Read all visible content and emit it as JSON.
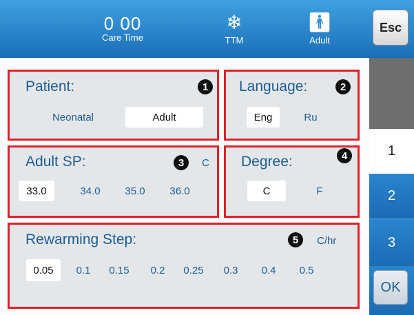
{
  "header": {
    "care_time_value": "0 00",
    "care_time_label": "Care Time",
    "ttm_icon": "snowflake-icon",
    "ttm_label": "TTM",
    "adult_icon": "person-icon",
    "adult_label": "Adult",
    "esc_label": "Esc"
  },
  "side_tabs": {
    "tab1": "1",
    "tab2": "2",
    "tab3": "3",
    "ok_label": "OK"
  },
  "patient": {
    "title": "Patient:",
    "badge": "1",
    "options": [
      "Neonatal",
      "Adult"
    ],
    "selected": "Adult"
  },
  "language": {
    "title": "Language:",
    "badge": "2",
    "options": [
      "Eng",
      "Ru"
    ],
    "selected": "Eng"
  },
  "adult_sp": {
    "title": "Adult SP:",
    "badge": "3",
    "unit": "C",
    "options": [
      "33.0",
      "34.0",
      "35.0",
      "36.0"
    ],
    "selected": "33.0"
  },
  "degree": {
    "title": "Degree:",
    "badge": "4",
    "options": [
      "C",
      "F"
    ],
    "selected": "C"
  },
  "rewarming": {
    "title": "Rewarming Step:",
    "badge": "5",
    "unit": "C/hr",
    "options": [
      "0.05",
      "0.1",
      "0.15",
      "0.2",
      "0.25",
      "0.3",
      "0.4",
      "0.5"
    ],
    "selected": "0.05"
  },
  "colors": {
    "header_blue": "#1f78c1",
    "box_border": "#e0202a",
    "text_blue": "#1d5c93"
  }
}
